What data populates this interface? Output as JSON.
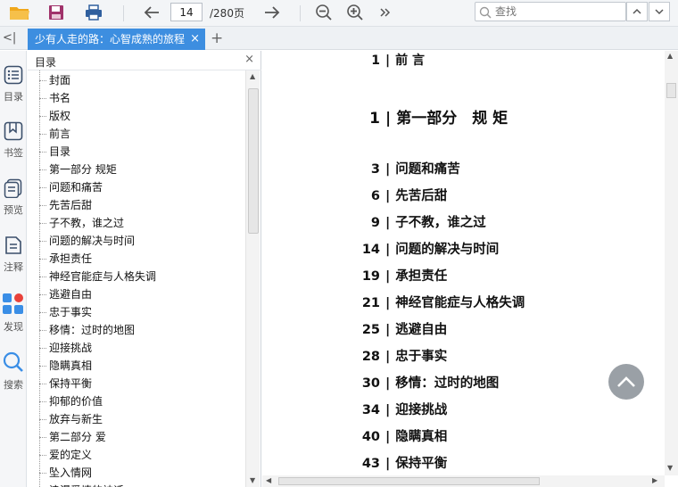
{
  "toolbar": {
    "page_current": "14",
    "page_total": "/280页",
    "search_placeholder": "查找",
    "icons": [
      "open-folder-icon",
      "save-icon",
      "print-icon",
      "back-arrow-icon",
      "forward-arrow-icon",
      "zoom-out-icon",
      "zoom-in-icon",
      "more-icon",
      "search-icon",
      "chevron-up-icon",
      "chevron-down-icon"
    ]
  },
  "tabs": {
    "active_tab": "少有人走的路：心智成熟的旅程",
    "close_glyph": "×",
    "collapse_glyph": "<|",
    "add_glyph": "+"
  },
  "rail": {
    "items": [
      {
        "label": "目录",
        "icon": "list-icon"
      },
      {
        "label": "书签",
        "icon": "bookmark-icon"
      },
      {
        "label": "预览",
        "icon": "preview-icon"
      },
      {
        "label": "注释",
        "icon": "annotation-icon"
      },
      {
        "label": "发现",
        "icon": "discover-icon"
      },
      {
        "label": "搜索",
        "icon": "search-icon"
      }
    ]
  },
  "outline": {
    "title": "目录",
    "close_glyph": "×",
    "items": [
      "封面",
      "书名",
      "版权",
      "前言",
      "目录",
      "第一部分 规矩",
      "问题和痛苦",
      "先苦后甜",
      "子不教，谁之过",
      "问题的解决与时间",
      "承担责任",
      "神经官能症与人格失调",
      "逃避自由",
      "忠于事实",
      "移情：过时的地图",
      "迎接挑战",
      "隐瞒真相",
      "保持平衡",
      "抑郁的价值",
      "放弃与新生",
      "第二部分 爱",
      "爱的定义",
      "坠入情网",
      "浪漫爱情的神话"
    ]
  },
  "document": {
    "toc": [
      {
        "page": "1",
        "title": "前 言"
      },
      {
        "page": "1",
        "title": "第一部分　规 矩"
      },
      {
        "page": "3",
        "title": "问题和痛苦"
      },
      {
        "page": "6",
        "title": "先苦后甜"
      },
      {
        "page": "9",
        "title": "子不教，谁之过"
      },
      {
        "page": "14",
        "title": "问题的解决与时间"
      },
      {
        "page": "19",
        "title": "承担责任"
      },
      {
        "page": "21",
        "title": "神经官能症与人格失调"
      },
      {
        "page": "25",
        "title": "逃避自由"
      },
      {
        "page": "28",
        "title": "忠于事实"
      },
      {
        "page": "30",
        "title": "移情：过时的地图"
      },
      {
        "page": "34",
        "title": "迎接挑战"
      },
      {
        "page": "40",
        "title": "隐瞒真相"
      },
      {
        "page": "43",
        "title": "保持平衡"
      }
    ],
    "separator": "|"
  },
  "colors": {
    "tab_accent": "#3d8ee0",
    "back_to_top": "#9aa0a6",
    "folder": "#f0a81c",
    "save": "#a0336b",
    "discover_red": "#e8413a",
    "discover_blue": "#3a8ee6"
  }
}
